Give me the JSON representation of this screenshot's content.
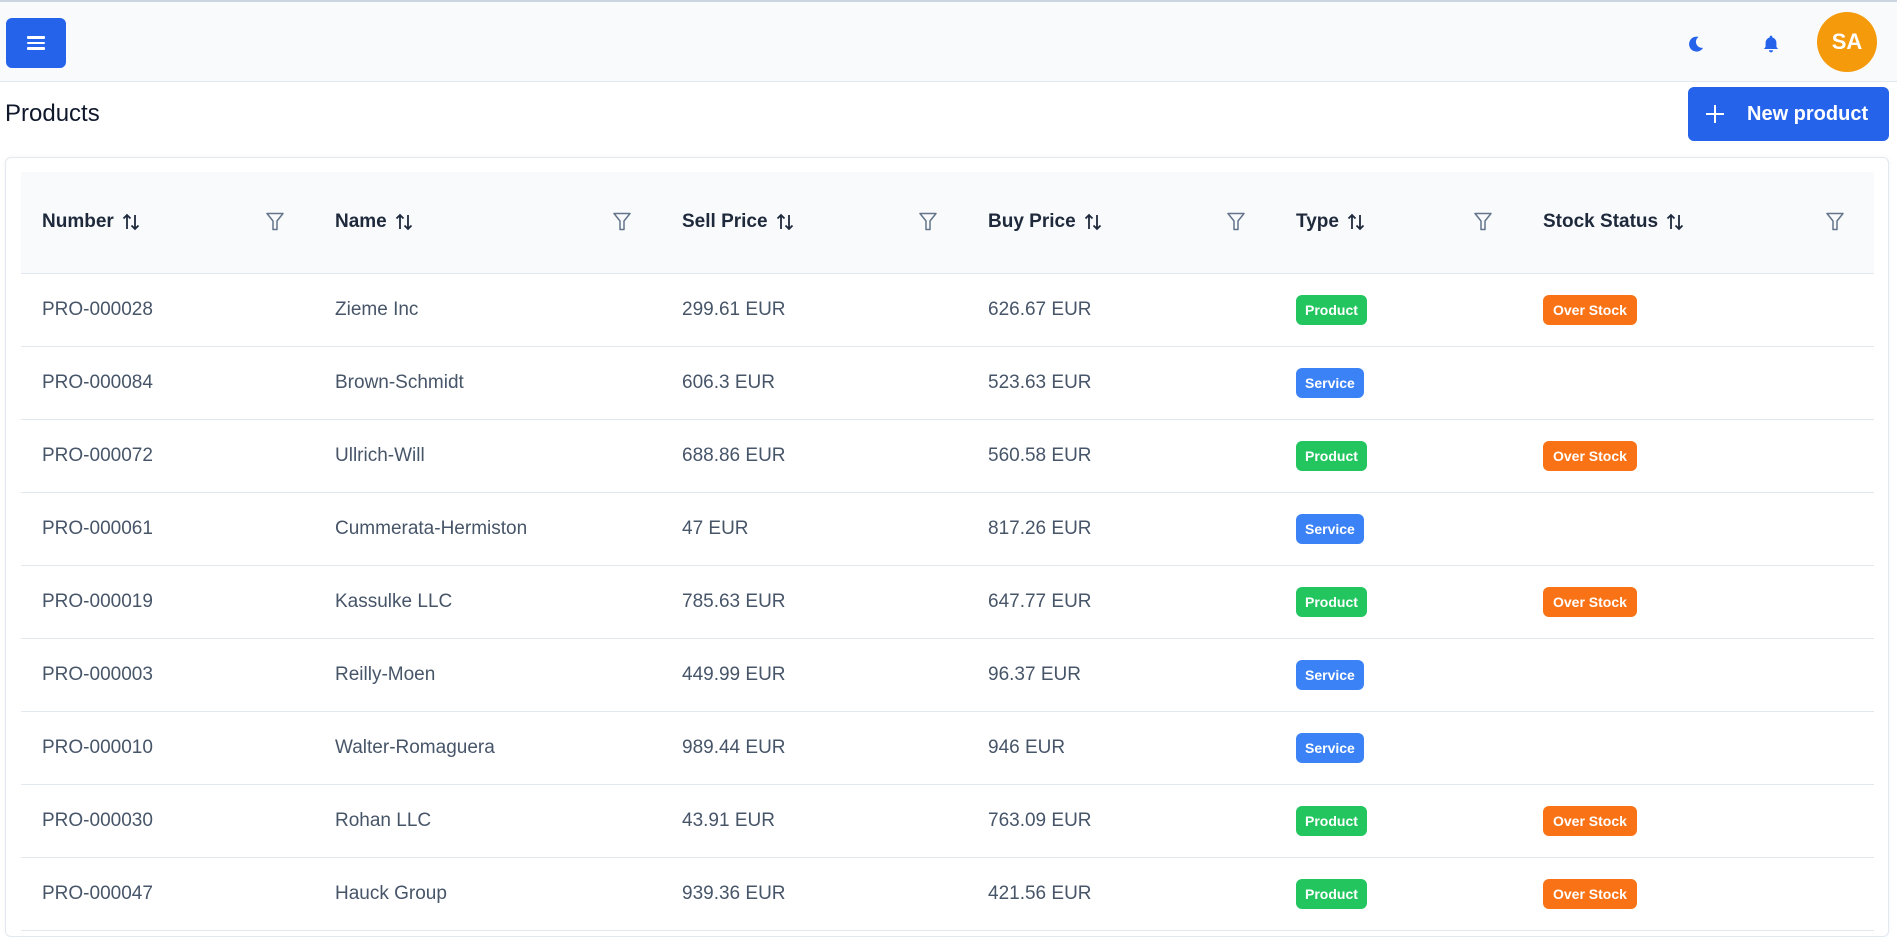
{
  "topbar": {
    "menu_icon": "hamburger-menu-icon",
    "theme_icon": "moon-icon",
    "notification_icon": "bell-icon",
    "avatar_initials": "SA",
    "accent_color": "#2563eb",
    "avatar_color": "#f59a0b"
  },
  "page": {
    "title": "Products",
    "new_button_label": "New product",
    "new_button_icon": "plus-icon"
  },
  "table": {
    "columns": [
      {
        "label": "Number",
        "sort_icon": "sort-icon",
        "filter_icon": "filter-icon"
      },
      {
        "label": "Name",
        "sort_icon": "sort-icon",
        "filter_icon": "filter-icon"
      },
      {
        "label": "Sell Price",
        "sort_icon": "sort-icon",
        "filter_icon": "filter-icon"
      },
      {
        "label": "Buy Price",
        "sort_icon": "sort-icon",
        "filter_icon": "filter-icon"
      },
      {
        "label": "Type",
        "sort_icon": "sort-icon",
        "filter_icon": "filter-icon"
      },
      {
        "label": "Stock Status",
        "sort_icon": "sort-icon",
        "filter_icon": "filter-icon"
      }
    ],
    "rows": [
      {
        "number": "PRO-000028",
        "name": "Zieme Inc",
        "sell_price": "299.61 EUR",
        "buy_price": "626.67 EUR",
        "type": "Product",
        "stock_status": "Over Stock"
      },
      {
        "number": "PRO-000084",
        "name": "Brown-Schmidt",
        "sell_price": "606.3 EUR",
        "buy_price": "523.63 EUR",
        "type": "Service",
        "stock_status": ""
      },
      {
        "number": "PRO-000072",
        "name": "Ullrich-Will",
        "sell_price": "688.86 EUR",
        "buy_price": "560.58 EUR",
        "type": "Product",
        "stock_status": "Over Stock"
      },
      {
        "number": "PRO-000061",
        "name": "Cummerata-Hermiston",
        "sell_price": "47 EUR",
        "buy_price": "817.26 EUR",
        "type": "Service",
        "stock_status": ""
      },
      {
        "number": "PRO-000019",
        "name": "Kassulke LLC",
        "sell_price": "785.63 EUR",
        "buy_price": "647.77 EUR",
        "type": "Product",
        "stock_status": "Over Stock"
      },
      {
        "number": "PRO-000003",
        "name": "Reilly-Moen",
        "sell_price": "449.99 EUR",
        "buy_price": "96.37 EUR",
        "type": "Service",
        "stock_status": ""
      },
      {
        "number": "PRO-000010",
        "name": "Walter-Romaguera",
        "sell_price": "989.44 EUR",
        "buy_price": "946 EUR",
        "type": "Service",
        "stock_status": ""
      },
      {
        "number": "PRO-000030",
        "name": "Rohan LLC",
        "sell_price": "43.91 EUR",
        "buy_price": "763.09 EUR",
        "type": "Product",
        "stock_status": "Over Stock"
      },
      {
        "number": "PRO-000047",
        "name": "Hauck Group",
        "sell_price": "939.36 EUR",
        "buy_price": "421.56 EUR",
        "type": "Product",
        "stock_status": "Over Stock"
      }
    ],
    "badge_colors": {
      "Product": "#22c55e",
      "Service": "#3b82f6",
      "Over Stock": "#f97316"
    }
  }
}
